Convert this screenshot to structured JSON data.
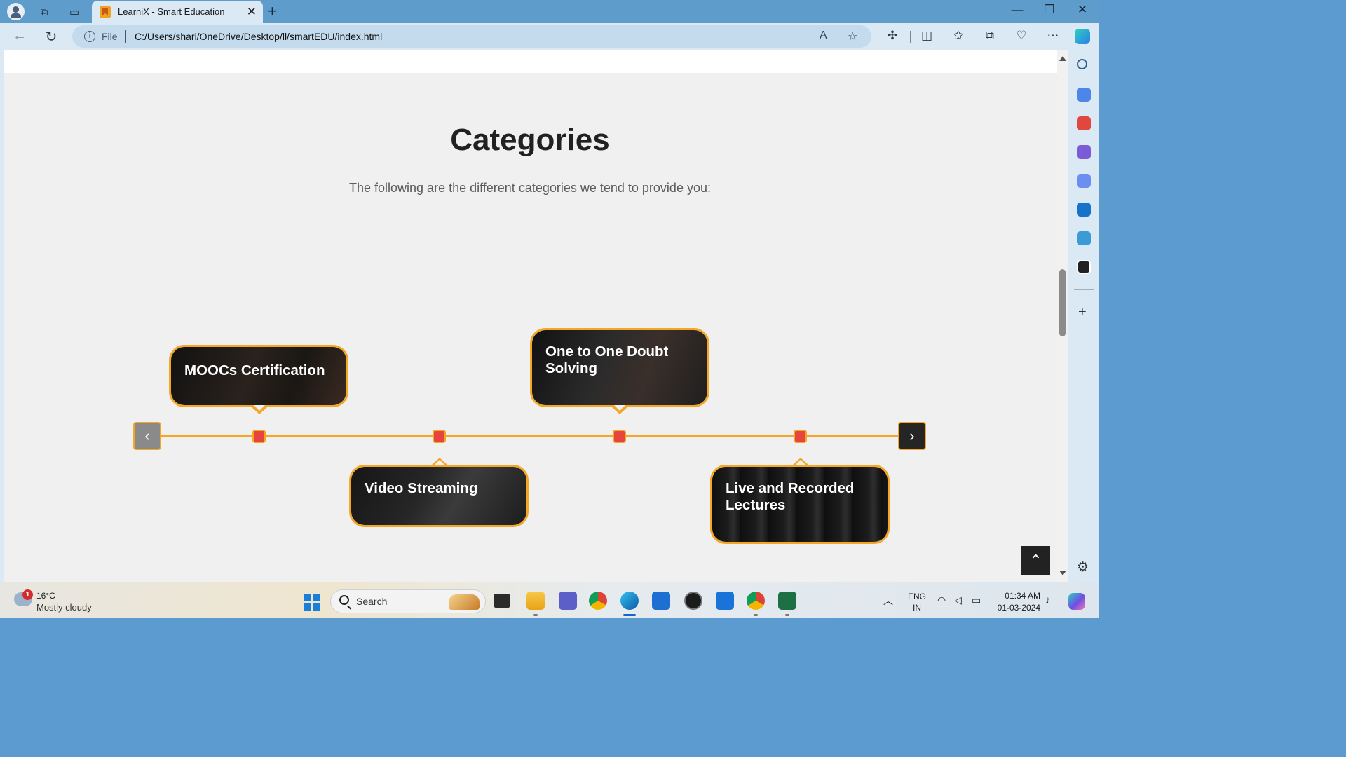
{
  "browser": {
    "tab_title": "LearniX - Smart Education",
    "address_scheme": "File",
    "address_url": "C:/Users/shari/OneDrive/Desktop/ll/smartEDU/index.html",
    "new_tab": "+",
    "close_tab": "✕",
    "minimize": "—",
    "restore": "❐",
    "close": "✕"
  },
  "page": {
    "title": "Categories",
    "subtitle": "The following are the different categories we tend to provide you:",
    "timeline": {
      "prev_label": "‹",
      "next_label": "›",
      "accent_color": "#f5a623",
      "dot_color": "#e5443f",
      "cards": [
        {
          "label": "MOOCs Certification",
          "position": "above"
        },
        {
          "label": "Video Streaming",
          "position": "below"
        },
        {
          "label": "One to One Doubt Solving",
          "position": "above"
        },
        {
          "label": "Live and Recorded Lectures",
          "position": "below"
        }
      ]
    },
    "back_to_top": "⌃"
  },
  "taskbar": {
    "weather_badge": "1",
    "weather_temp": "16°C",
    "weather_desc": "Mostly cloudy",
    "search_label": "Search",
    "lang_line1": "ENG",
    "lang_line2": "IN",
    "time": "01:34 AM",
    "date": "01-03-2024"
  }
}
